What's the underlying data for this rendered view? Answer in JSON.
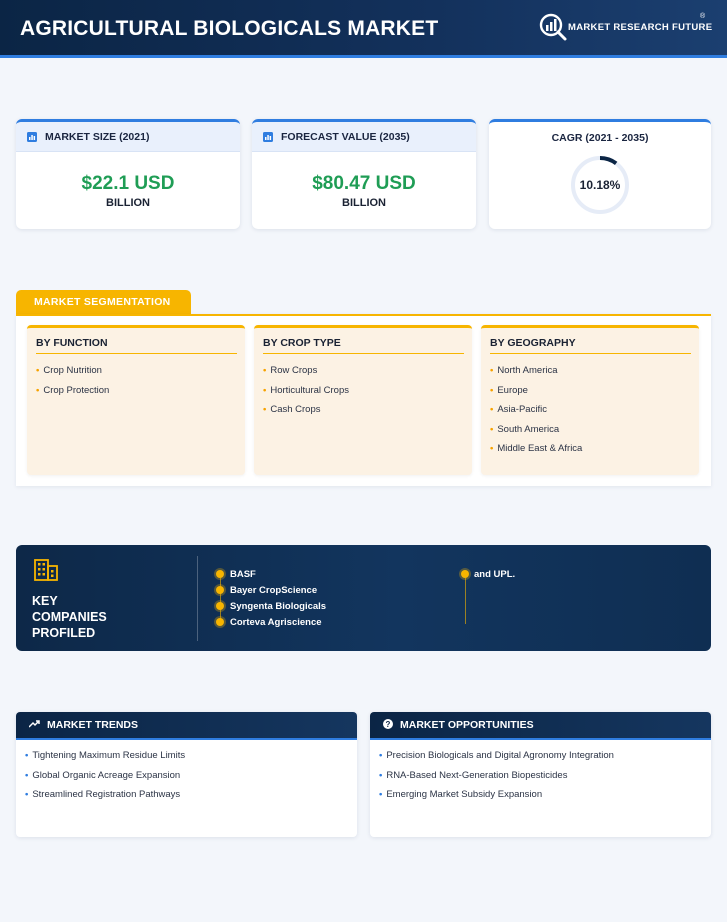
{
  "header": {
    "title": "AGRICULTURAL BIOLOGICALS MARKET",
    "logo_text": "MARKET RESEARCH FUTURE",
    "logo_reg": "®"
  },
  "stats": {
    "market_size": {
      "label": "MARKET SIZE (2021)",
      "value": "$22.1 USD",
      "unit": "BILLION"
    },
    "forecast": {
      "label": "FORECAST VALUE (2035)",
      "value": "$80.47 USD",
      "unit": "BILLION"
    },
    "cagr": {
      "label": "CAGR (2021 - 2035)",
      "value": "10.18%",
      "ring_fraction": 0.1018
    }
  },
  "segmentation": {
    "tab_label": "MARKET SEGMENTATION",
    "columns": [
      {
        "title": "BY FUNCTION",
        "items": [
          "Crop Nutrition",
          "Crop Protection"
        ]
      },
      {
        "title": "BY CROP TYPE",
        "items": [
          "Row Crops",
          "Horticultural Crops",
          "Cash Crops"
        ]
      },
      {
        "title": "BY GEOGRAPHY",
        "items": [
          "North America",
          "Europe",
          "Asia-Pacific",
          "South America",
          "Middle East & Africa"
        ]
      }
    ]
  },
  "companies": {
    "title": "KEY COMPANIES PROFILED",
    "title_lines": [
      "KEY",
      "COMPANIES",
      "PROFILED"
    ],
    "items": [
      "BASF",
      "Bayer CropScience",
      "Syngenta Biologicals",
      "Corteva Agriscience",
      "and UPL."
    ]
  },
  "trends": {
    "title": "MARKET TRENDS",
    "items": [
      "Tightening Maximum Residue Limits",
      "Global Organic Acreage Expansion",
      "Streamlined Registration Pathways"
    ]
  },
  "opportunities": {
    "title": "MARKET OPPORTUNITIES",
    "items": [
      "Precision Biologicals and Digital Agronomy Integration",
      "RNA-Based Next-Generation Biopesticides",
      "Emerging Market Subsidy Expansion"
    ]
  },
  "colors": {
    "accent_blue": "#2f7de0",
    "accent_yellow": "#f7b500",
    "value_green": "#1f9d55",
    "navy": "#0b2545"
  }
}
